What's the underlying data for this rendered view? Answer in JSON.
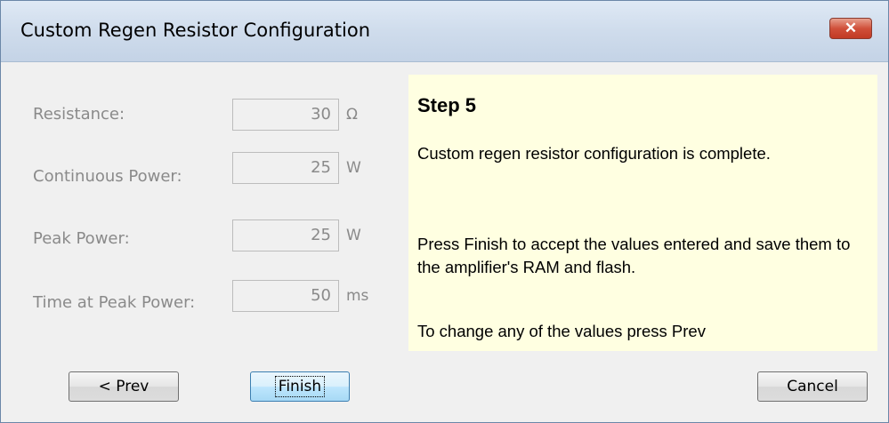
{
  "window": {
    "title": "Custom Regen Resistor Configuration",
    "close_glyph": "✕"
  },
  "fields": [
    {
      "label": "Resistance:",
      "value": "30",
      "unit": "Ω"
    },
    {
      "label": "Continuous Power:",
      "value": "25",
      "unit": "W"
    },
    {
      "label": "Peak Power:",
      "value": "25",
      "unit": "W"
    },
    {
      "label": "Time at Peak Power:",
      "value": "50",
      "unit": "ms"
    }
  ],
  "info": {
    "step_title": "Step 5",
    "paragraphs": [
      "Custom regen resistor configuration is complete.",
      "Press Finish to accept the values entered and save them to the amplifier's RAM and flash.",
      "To change any of the values press Prev"
    ]
  },
  "buttons": {
    "prev": "< Prev",
    "finish": "Finish",
    "cancel": "Cancel"
  },
  "colors": {
    "info_background": "#ffffe1",
    "disabled_text": "#8a8a8a",
    "close_button": "#c23a24"
  }
}
